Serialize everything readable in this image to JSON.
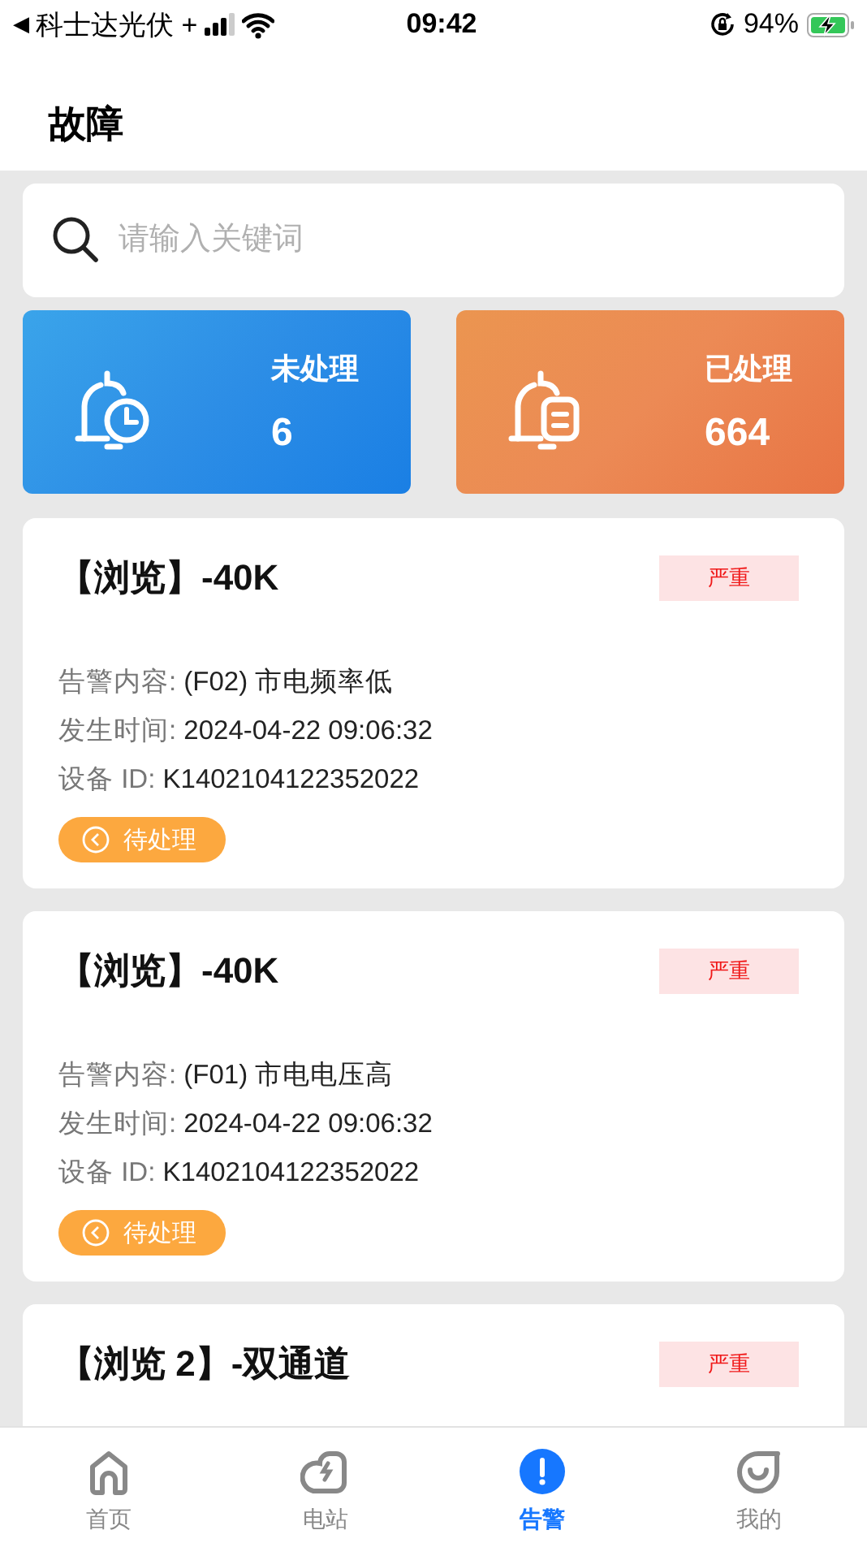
{
  "status_bar": {
    "back": "◀",
    "carrier": "科士达光伏 +",
    "time": "09:42",
    "battery": "94%"
  },
  "header": {
    "title": "故障"
  },
  "search": {
    "placeholder": "请输入关键词"
  },
  "stats": [
    {
      "kind": "pending",
      "label": "未处理",
      "count": "6"
    },
    {
      "kind": "processed",
      "label": "已处理",
      "count": "664"
    }
  ],
  "alerts": [
    {
      "title": "【浏览】-40K",
      "severity": "严重",
      "fields": [
        {
          "label": "告警内容:",
          "value": "(F02) 市电频率低"
        },
        {
          "label": "发生时间:",
          "value": "2024-04-22 09:06:32"
        },
        {
          "label": "设备 ID:",
          "value": "K1402104122352022"
        }
      ],
      "status": "待处理"
    },
    {
      "title": "【浏览】-40K",
      "severity": "严重",
      "fields": [
        {
          "label": "告警内容:",
          "value": "(F01) 市电电压高"
        },
        {
          "label": "发生时间:",
          "value": "2024-04-22 09:06:32"
        },
        {
          "label": "设备 ID:",
          "value": "K1402104122352022"
        }
      ],
      "status": "待处理"
    },
    {
      "title": "【浏览 2】-双通道",
      "severity": "严重"
    }
  ],
  "tabs": [
    {
      "kind": "home",
      "label": "首页",
      "selected": false
    },
    {
      "kind": "station",
      "label": "电站",
      "selected": false
    },
    {
      "kind": "alert",
      "label": "告警",
      "selected": true
    },
    {
      "kind": "profile",
      "label": "我的",
      "selected": false
    }
  ]
}
